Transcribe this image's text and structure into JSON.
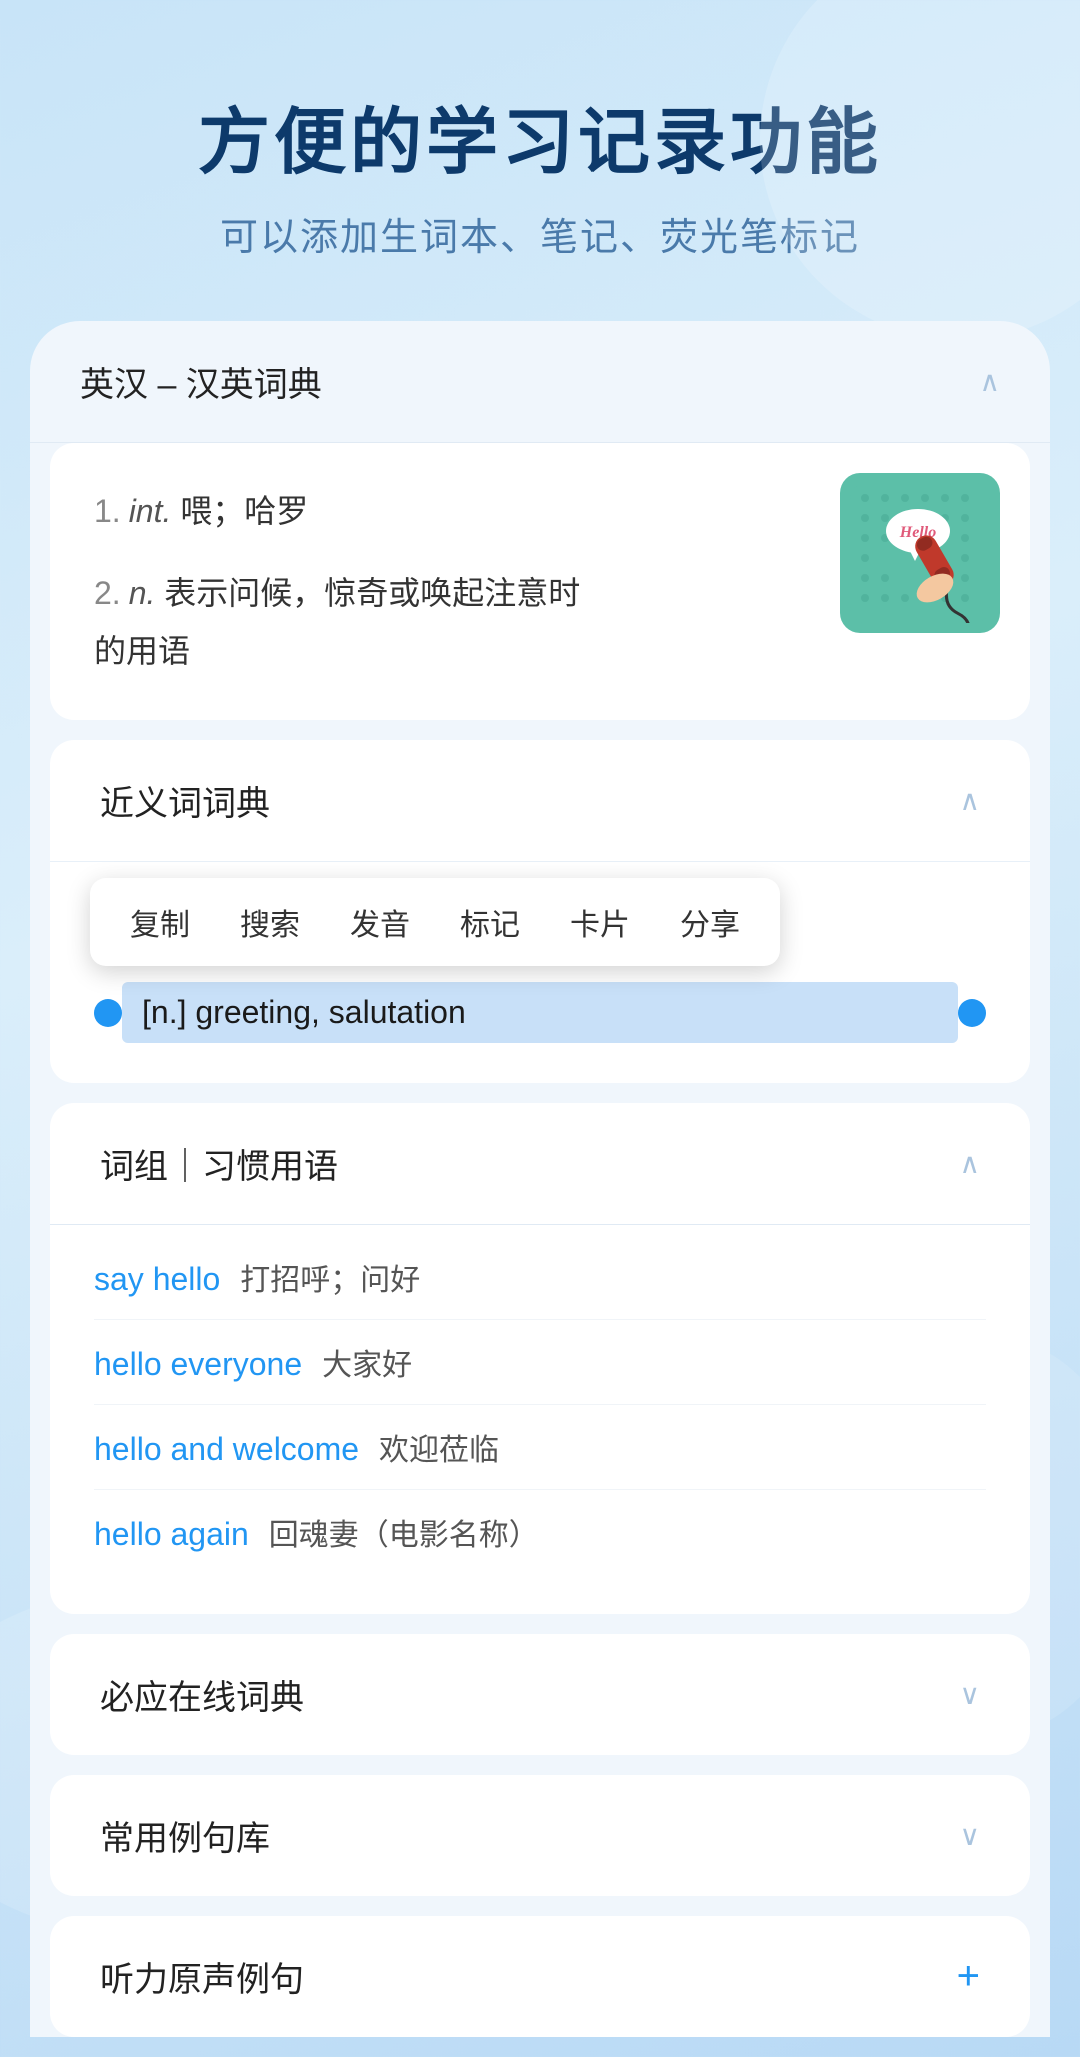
{
  "header": {
    "title": "方便的学习记录功能",
    "subtitle": "可以添加生词本、笔记、荧光笔标记"
  },
  "eng_dict_section": {
    "label": "英汉 – 汉英词典",
    "chevron": "∧",
    "entries": [
      {
        "num": "1.",
        "pos": "int.",
        "meaning": "喂；哈罗"
      },
      {
        "num": "2.",
        "pos": "n.",
        "meaning": "表示问候，惊奇或唤起注意时的用语"
      }
    ]
  },
  "synonym_section": {
    "label": "近义词词典",
    "chevron": "∧",
    "highlighted": "[n.] greeting, salutation"
  },
  "context_menu": {
    "items": [
      "复制",
      "搜索",
      "发音",
      "标记",
      "卡片",
      "分享"
    ]
  },
  "phrases_section": {
    "label": "词组｜习惯用语",
    "chevron": "∧",
    "phrases": [
      {
        "en": "say hello",
        "zh": "打招呼；问好"
      },
      {
        "en": "hello everyone",
        "zh": "大家好"
      },
      {
        "en": "hello and welcome",
        "zh": "欢迎莅临"
      },
      {
        "en": "hello again",
        "zh": "回魂妻（电影名称）"
      }
    ]
  },
  "biyingSection": {
    "label": "必应在线词典",
    "chevron": "∨"
  },
  "changyongSection": {
    "label": "常用例句库",
    "chevron": "∨"
  },
  "tingli_section": {
    "label": "听力原声例句",
    "plus": "+"
  }
}
